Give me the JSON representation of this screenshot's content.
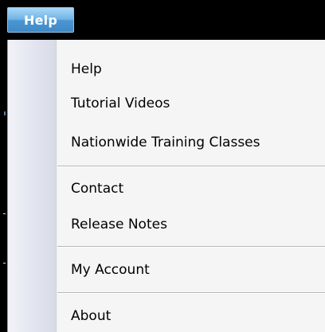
{
  "menubar": {
    "help_label": "Help"
  },
  "menu": {
    "items": [
      {
        "label": "Help"
      },
      {
        "label": "Tutorial Videos"
      },
      {
        "label": "Nationwide Training Classes"
      },
      {
        "label": "Contact"
      },
      {
        "label": "Release Notes"
      },
      {
        "label": "My Account"
      },
      {
        "label": "About"
      }
    ]
  }
}
